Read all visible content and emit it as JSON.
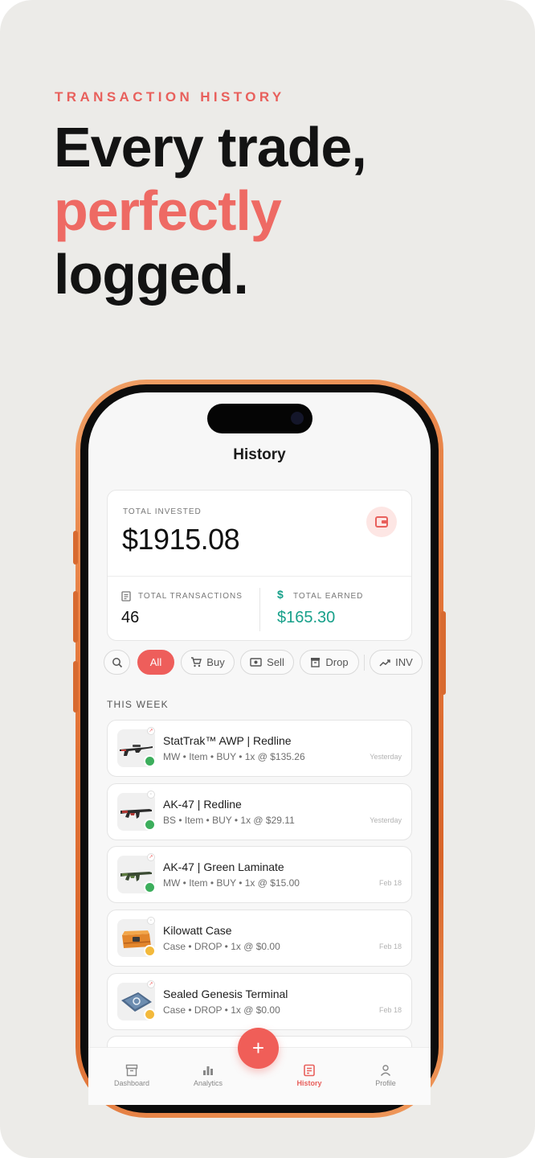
{
  "hero": {
    "eyebrow": "TRANSACTION HISTORY",
    "line1": "Every trade,",
    "line2": "perfectly",
    "line3": "logged."
  },
  "app": {
    "title": "History",
    "summary": {
      "invested_label": "TOTAL INVESTED",
      "invested_value": "$1915.08",
      "transactions_label": "TOTAL TRANSACTIONS",
      "transactions_value": "46",
      "earned_label": "TOTAL EARNED",
      "earned_value": "$165.30"
    },
    "filters": [
      {
        "label": "All",
        "icon": "none",
        "active": true
      },
      {
        "label": "Buy",
        "icon": "cart-icon",
        "active": false
      },
      {
        "label": "Sell",
        "icon": "cash-icon",
        "active": false
      },
      {
        "label": "Drop",
        "icon": "box-icon",
        "active": false
      },
      {
        "label": "INV",
        "icon": "trend-icon",
        "active": false
      }
    ],
    "section_title": "THIS WEEK",
    "transactions": [
      {
        "name": "StatTrak™ AWP | Redline",
        "meta": "MW • Item • BUY • 1x @ $135.26",
        "date": "Yesterday",
        "type": "buy",
        "thumb": "awp"
      },
      {
        "name": "AK-47 | Redline",
        "meta": "BS • Item • BUY • 1x @ $29.11",
        "date": "Yesterday",
        "type": "buy",
        "thumb": "ak"
      },
      {
        "name": "AK-47 | Green Laminate",
        "meta": "MW • Item • BUY • 1x @ $15.00",
        "date": "Feb 18",
        "type": "buy",
        "thumb": "ak-green"
      },
      {
        "name": "Kilowatt Case",
        "meta": "Case • DROP • 1x @ $0.00",
        "date": "Feb 18",
        "type": "drop",
        "thumb": "case"
      },
      {
        "name": "Sealed Genesis Terminal",
        "meta": "Case • DROP • 1x @ $0.00",
        "date": "Feb 18",
        "type": "drop",
        "thumb": "terminal"
      }
    ],
    "tabs": [
      {
        "label": "Dashboard",
        "icon": "archive-icon",
        "active": false
      },
      {
        "label": "Analytics",
        "icon": "bar-chart-icon",
        "active": false
      },
      {
        "label": "History",
        "icon": "receipt-icon",
        "active": true
      },
      {
        "label": "Profile",
        "icon": "person-icon",
        "active": false
      }
    ],
    "fab_label": "+"
  },
  "colors": {
    "accent": "#ee5e5b",
    "earned": "#17a08a",
    "phone": "#e5773a"
  }
}
